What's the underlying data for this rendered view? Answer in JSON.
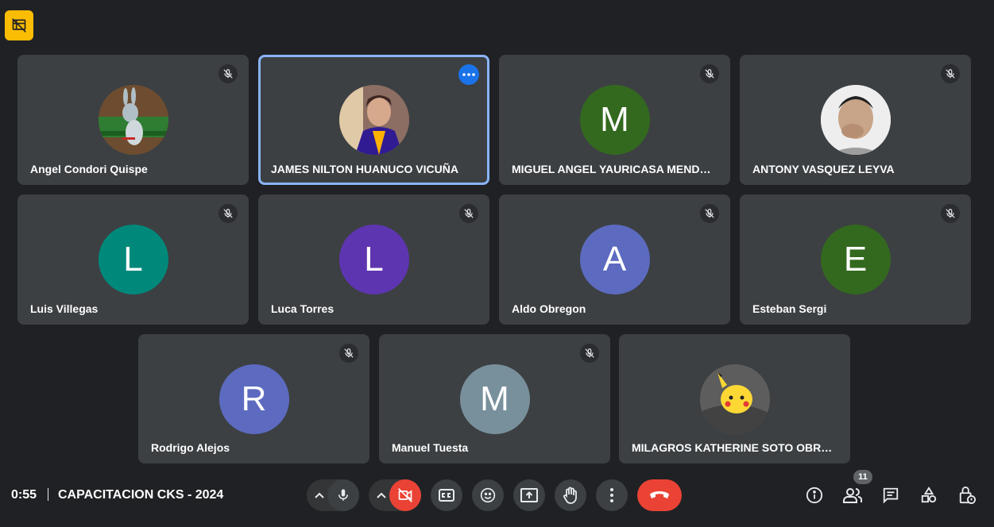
{
  "meeting": {
    "time": "0:55",
    "title": "CAPACITACION CKS - 2024",
    "participants_count": "11"
  },
  "participants": [
    {
      "name": "Angel Condori Quispe",
      "avatar_type": "photo",
      "photo_desc": "cartoon-rabbit-on-bench",
      "muted": true
    },
    {
      "name": "JAMES NILTON HUANUCO VICUÑA",
      "avatar_type": "photo",
      "photo_desc": "person-portrait",
      "muted": false,
      "active_speaker": true
    },
    {
      "name": "MIGUEL ANGEL YAURICASA MENDO...",
      "initial": "M",
      "avatar_color": "#33691e",
      "muted": true
    },
    {
      "name": "ANTONY VASQUEZ LEYVA",
      "avatar_type": "photo",
      "photo_desc": "person-portrait",
      "muted": true
    },
    {
      "name": "Luis Villegas",
      "initial": "L",
      "avatar_color": "#00897b",
      "muted": true
    },
    {
      "name": "Luca Torres",
      "initial": "L",
      "avatar_color": "#5e35b1",
      "muted": true
    },
    {
      "name": "Aldo Obregon",
      "initial": "A",
      "avatar_color": "#5c6bc0",
      "muted": true
    },
    {
      "name": "Esteban Sergi",
      "initial": "E",
      "avatar_color": "#33691e",
      "muted": true
    },
    {
      "name": "Rodrigo Alejos",
      "initial": "R",
      "avatar_color": "#5c6bc0",
      "muted": true
    },
    {
      "name": "Manuel Tuesta",
      "initial": "M",
      "avatar_color": "#78909c",
      "muted": true
    },
    {
      "name": "MILAGROS KATHERINE SOTO OBREG...",
      "avatar_type": "photo",
      "photo_desc": "pikachu-plush",
      "muted": false
    }
  ],
  "controls": {
    "mic": "microphone-icon",
    "camera_off": "camera-off-icon",
    "captions": "captions-icon",
    "reactions": "emoji-icon",
    "present": "present-screen-icon",
    "raise_hand": "hand-icon",
    "more": "more-options-icon",
    "end_call": "end-call-icon"
  },
  "right_controls": [
    "info-icon",
    "people-icon",
    "chat-icon",
    "activities-icon",
    "host-controls-icon"
  ],
  "colors": {
    "background": "#202124",
    "tile": "#3c4043",
    "active_border": "#8ab4f8",
    "end_call": "#ea4335",
    "top_badge": "#fbbc04"
  }
}
